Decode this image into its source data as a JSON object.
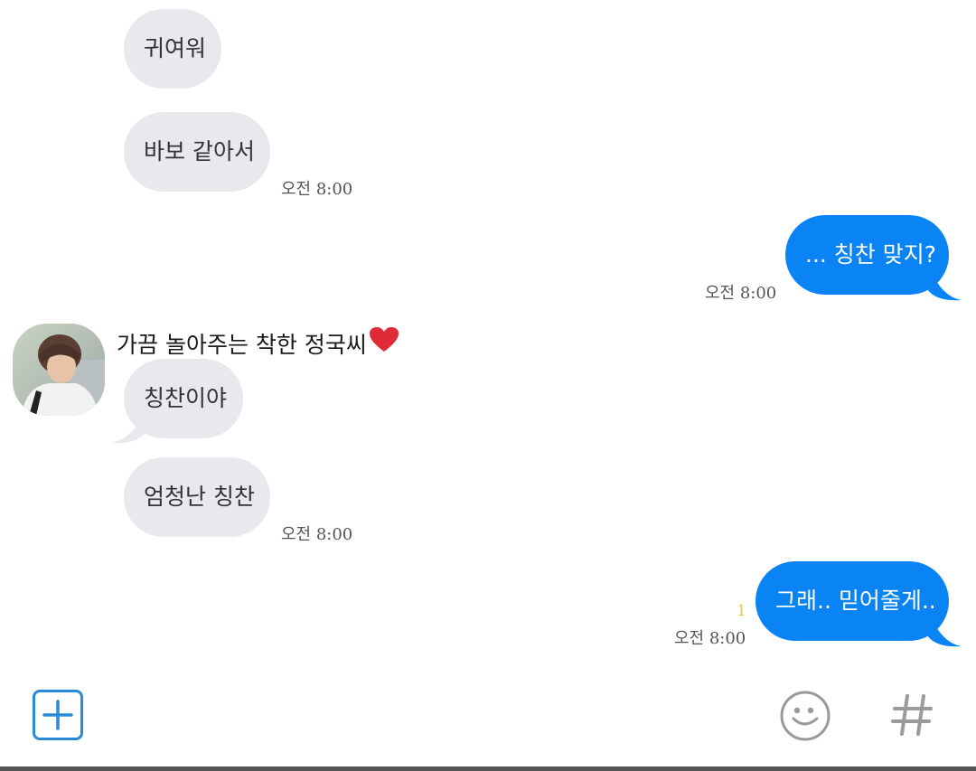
{
  "colors": {
    "received_bubble": "#e8e8ed",
    "sent_bubble": "#0a84f5",
    "icon_blue": "#2a8ad8",
    "icon_gray": "#9a9a9a",
    "read_count": "#e5c84d"
  },
  "chat": {
    "messages": [
      {
        "direction": "received",
        "text": "귀여워"
      },
      {
        "direction": "received",
        "text": "바보 같아서",
        "time": "오전 8:00"
      },
      {
        "direction": "sent",
        "text": "... 칭찬 맞지?",
        "time": "오전 8:00"
      },
      {
        "direction": "received",
        "sender": "가끔 놀아주는 착한 정국씨",
        "text": "칭찬이야"
      },
      {
        "direction": "received",
        "text": "엄청난 칭찬",
        "time": "오전 8:00"
      },
      {
        "direction": "sent",
        "text": "그래.. 믿어줄게..",
        "time": "오전 8:00",
        "unread": "1"
      }
    ]
  },
  "input_bar": {
    "icons": [
      "plus-icon",
      "emoji-icon",
      "hash-icon"
    ]
  }
}
